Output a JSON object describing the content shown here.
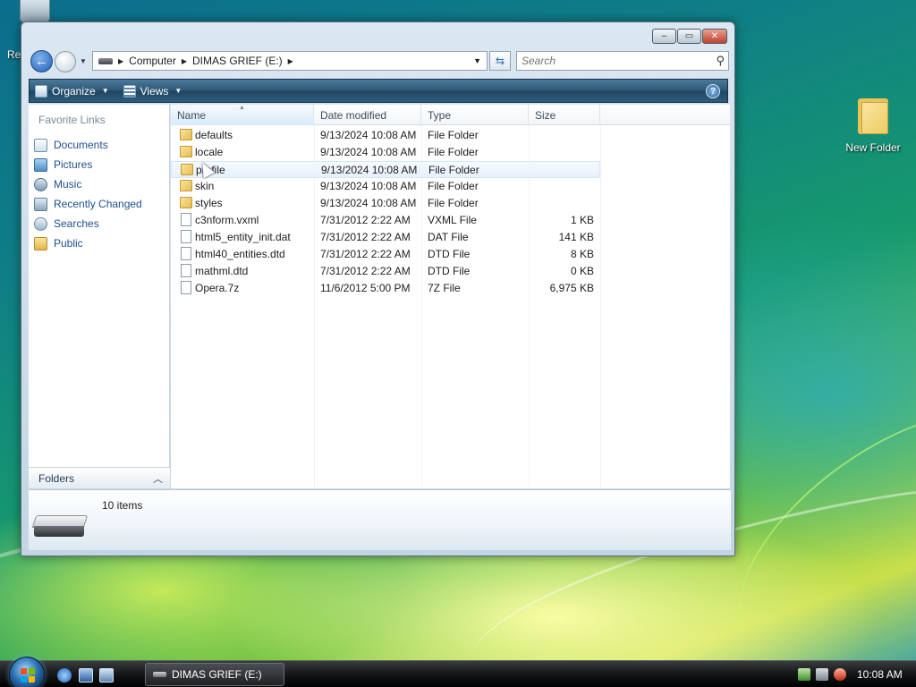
{
  "desktop": {
    "recycle_bin_label": "Re",
    "new_folder_label": "New Folder"
  },
  "window": {
    "caption_buttons": {
      "minimize": "–",
      "maximize": "▭",
      "close": "✕"
    },
    "address": {
      "crumbs": [
        "Computer",
        "DIMAS GRIEF (E:)"
      ]
    },
    "search": {
      "placeholder": "Search"
    },
    "toolbar": {
      "organize_label": "Organize",
      "views_label": "Views",
      "help_label": "?"
    },
    "nav_pane": {
      "title": "Favorite Links",
      "items": [
        {
          "label": "Documents",
          "icon": "documents-icon"
        },
        {
          "label": "Pictures",
          "icon": "pictures-icon"
        },
        {
          "label": "Music",
          "icon": "music-icon"
        },
        {
          "label": "Recently Changed",
          "icon": "recently-changed-icon"
        },
        {
          "label": "Searches",
          "icon": "searches-icon"
        },
        {
          "label": "Public",
          "icon": "public-folder-icon"
        }
      ],
      "folders_label": "Folders"
    },
    "columns": [
      "Name",
      "Date modified",
      "Type",
      "Size"
    ],
    "files": [
      {
        "name": "defaults",
        "date": "9/13/2024 10:08 AM",
        "type": "File Folder",
        "size": "",
        "kind": "folder"
      },
      {
        "name": "locale",
        "date": "9/13/2024 10:08 AM",
        "type": "File Folder",
        "size": "",
        "kind": "folder"
      },
      {
        "name": "profile",
        "date": "9/13/2024 10:08 AM",
        "type": "File Folder",
        "size": "",
        "kind": "folder"
      },
      {
        "name": "skin",
        "date": "9/13/2024 10:08 AM",
        "type": "File Folder",
        "size": "",
        "kind": "folder"
      },
      {
        "name": "styles",
        "date": "9/13/2024 10:08 AM",
        "type": "File Folder",
        "size": "",
        "kind": "folder"
      },
      {
        "name": "c3nform.vxml",
        "date": "7/31/2012 2:22 AM",
        "type": "VXML File",
        "size": "1 KB",
        "kind": "file"
      },
      {
        "name": "html5_entity_init.dat",
        "date": "7/31/2012 2:22 AM",
        "type": "DAT File",
        "size": "141 KB",
        "kind": "file"
      },
      {
        "name": "html40_entities.dtd",
        "date": "7/31/2012 2:22 AM",
        "type": "DTD File",
        "size": "8 KB",
        "kind": "file"
      },
      {
        "name": "mathml.dtd",
        "date": "7/31/2012 2:22 AM",
        "type": "DTD File",
        "size": "0 KB",
        "kind": "file"
      },
      {
        "name": "Opera.7z",
        "date": "11/6/2012 5:00 PM",
        "type": "7Z File",
        "size": "6,975 KB",
        "kind": "file"
      }
    ],
    "details": {
      "item_count": "10 items"
    }
  },
  "taskbar": {
    "window_button_label": "DIMAS GRIEF (E:)",
    "clock": "10:08 AM"
  }
}
